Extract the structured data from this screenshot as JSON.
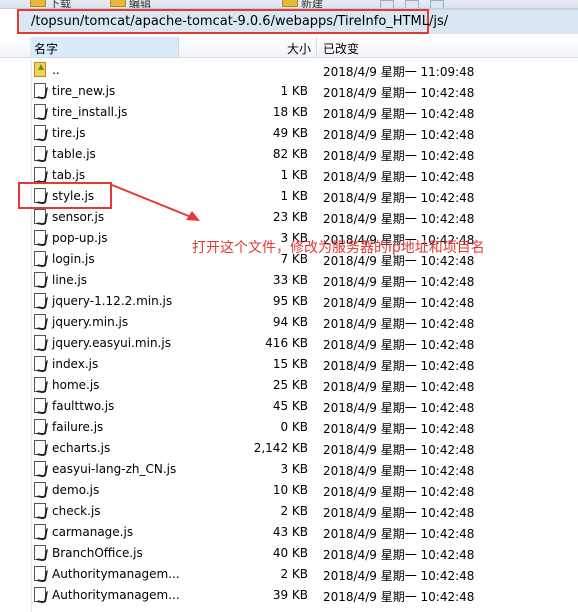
{
  "toolbar": {
    "items": [
      {
        "label": "下载"
      },
      {
        "label": "编辑"
      },
      {
        "label": "新建"
      }
    ]
  },
  "address": {
    "path": "/topsun/tomcat/apache-tomcat-9.0.6/webapps/TireInfo_HTML/js/"
  },
  "columns": {
    "name": "名字",
    "size": "大小",
    "modified": "已改变"
  },
  "files": [
    {
      "name": "..",
      "size": "",
      "date": "2018/4/9 星期一 11:09:48",
      "type": "parent"
    },
    {
      "name": "tire_new.js",
      "size": "1 KB",
      "date": "2018/4/9 星期一 10:42:48",
      "type": "js"
    },
    {
      "name": "tire_install.js",
      "size": "18 KB",
      "date": "2018/4/9 星期一 10:42:48",
      "type": "js"
    },
    {
      "name": "tire.js",
      "size": "49 KB",
      "date": "2018/4/9 星期一 10:42:48",
      "type": "js"
    },
    {
      "name": "table.js",
      "size": "82 KB",
      "date": "2018/4/9 星期一 10:42:48",
      "type": "js"
    },
    {
      "name": "tab.js",
      "size": "1 KB",
      "date": "2018/4/9 星期一 10:42:48",
      "type": "js"
    },
    {
      "name": "style.js",
      "size": "1 KB",
      "date": "2018/4/9 星期一 10:42:48",
      "type": "js"
    },
    {
      "name": "sensor.js",
      "size": "23 KB",
      "date": "2018/4/9 星期一 10:42:48",
      "type": "js"
    },
    {
      "name": "pop-up.js",
      "size": "3 KB",
      "date": "2018/4/9 星期一 10:42:48",
      "type": "js"
    },
    {
      "name": "login.js",
      "size": "7 KB",
      "date": "2018/4/9 星期一 10:42:48",
      "type": "js"
    },
    {
      "name": "line.js",
      "size": "33 KB",
      "date": "2018/4/9 星期一 10:42:48",
      "type": "js"
    },
    {
      "name": "jquery-1.12.2.min.js",
      "size": "95 KB",
      "date": "2018/4/9 星期一 10:42:48",
      "type": "js"
    },
    {
      "name": "jquery.min.js",
      "size": "94 KB",
      "date": "2018/4/9 星期一 10:42:48",
      "type": "js"
    },
    {
      "name": "jquery.easyui.min.js",
      "size": "416 KB",
      "date": "2018/4/9 星期一 10:42:48",
      "type": "js"
    },
    {
      "name": "index.js",
      "size": "15 KB",
      "date": "2018/4/9 星期一 10:42:48",
      "type": "js"
    },
    {
      "name": "home.js",
      "size": "25 KB",
      "date": "2018/4/9 星期一 10:42:48",
      "type": "js"
    },
    {
      "name": "faulttwo.js",
      "size": "45 KB",
      "date": "2018/4/9 星期一 10:42:48",
      "type": "js"
    },
    {
      "name": "failure.js",
      "size": "0 KB",
      "date": "2018/4/9 星期一 10:42:48",
      "type": "js"
    },
    {
      "name": "echarts.js",
      "size": "2,142 KB",
      "date": "2018/4/9 星期一 10:42:48",
      "type": "js"
    },
    {
      "name": "easyui-lang-zh_CN.js",
      "size": "3 KB",
      "date": "2018/4/9 星期一 10:42:48",
      "type": "js"
    },
    {
      "name": "demo.js",
      "size": "10 KB",
      "date": "2018/4/9 星期一 10:42:48",
      "type": "js"
    },
    {
      "name": "check.js",
      "size": "2 KB",
      "date": "2018/4/9 星期一 10:42:48",
      "type": "js"
    },
    {
      "name": "carmanage.js",
      "size": "43 KB",
      "date": "2018/4/9 星期一 10:42:48",
      "type": "js"
    },
    {
      "name": "BranchOffice.js",
      "size": "40 KB",
      "date": "2018/4/9 星期一 10:42:48",
      "type": "js"
    },
    {
      "name": "Authoritymanagem...",
      "size": "2 KB",
      "date": "2018/4/9 星期一 10:42:48",
      "type": "js"
    },
    {
      "name": "Authoritymanagem...",
      "size": "39 KB",
      "date": "2018/4/9 星期一 10:42:48",
      "type": "js"
    }
  ],
  "annotation": {
    "text": "打开这个文件，修改为服务器的ip地址和项目名",
    "color": "#e53935"
  }
}
